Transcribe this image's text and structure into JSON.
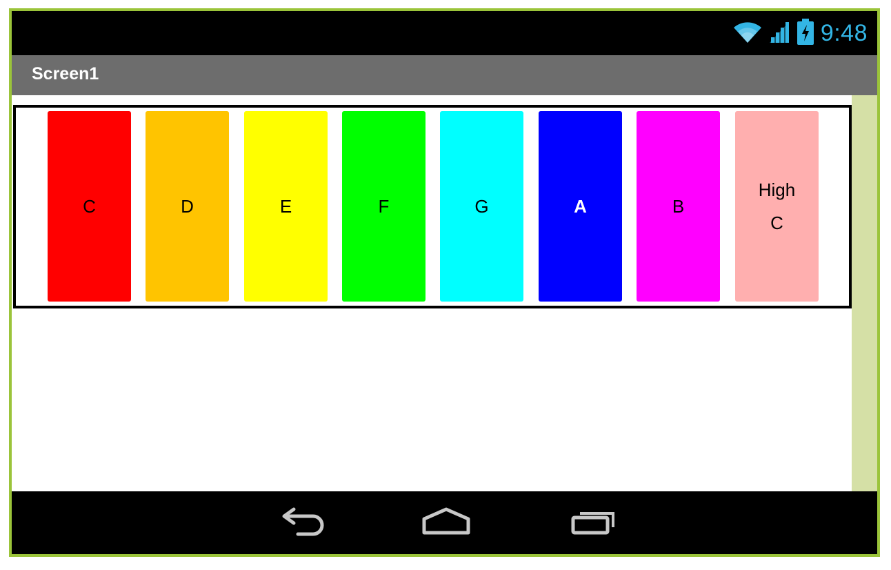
{
  "status_bar": {
    "time": "9:48",
    "icons": [
      "wifi-icon",
      "signal-icon",
      "battery-charging-icon"
    ],
    "accent_color": "#33b5e5"
  },
  "title_bar": {
    "title": "Screen1",
    "background_color": "#6d6d6d"
  },
  "keys": [
    {
      "label": "C",
      "color": "#ff0000",
      "text_color": "#000000"
    },
    {
      "label": "D",
      "color": "#ffc400",
      "text_color": "#000000"
    },
    {
      "label": "E",
      "color": "#ffff00",
      "text_color": "#000000"
    },
    {
      "label": "F",
      "color": "#00ff00",
      "text_color": "#000000"
    },
    {
      "label": "G",
      "color": "#00ffff",
      "text_color": "#000000"
    },
    {
      "label": "A",
      "color": "#0000ff",
      "text_color": "#ffffff"
    },
    {
      "label": "B",
      "color": "#ff00ff",
      "text_color": "#000000"
    },
    {
      "label_line1": "High",
      "label_line2": "C",
      "color": "#ffafaf",
      "text_color": "#000000"
    }
  ],
  "nav_bar": {
    "buttons": [
      "back-icon",
      "home-icon",
      "recent-apps-icon"
    ]
  },
  "device_frame_color": "#9bc43a"
}
